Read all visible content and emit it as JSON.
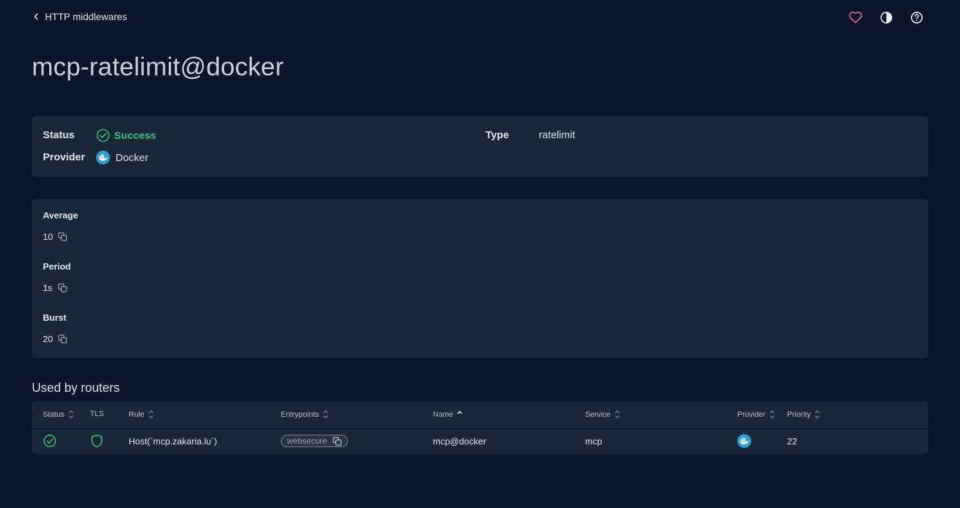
{
  "nav": {
    "back_label": "HTTP middlewares"
  },
  "header": {
    "icons": [
      "heart-icon",
      "contrast-icon",
      "help-icon"
    ]
  },
  "page": {
    "title": "mcp-ratelimit@docker"
  },
  "summary": {
    "status_label": "Status",
    "status_value": "Success",
    "provider_label": "Provider",
    "provider_value": "Docker",
    "type_label": "Type",
    "type_value": "ratelimit"
  },
  "config": {
    "average_label": "Average",
    "average_value": "10",
    "period_label": "Period",
    "period_value": "1s",
    "burst_label": "Burst",
    "burst_value": "20"
  },
  "routers": {
    "section_title": "Used by routers",
    "columns": {
      "status": "Status",
      "tls": "TLS",
      "rule": "Rule",
      "entrypoints": "Entrypoints",
      "name": "Name",
      "service": "Service",
      "provider": "Provider",
      "priority": "Priority"
    },
    "sorted_column": "name",
    "rows": [
      {
        "rule": "Host(`mcp.zakaria.lu`)",
        "entrypoint": "websecure",
        "name": "mcp@docker",
        "service": "mcp",
        "priority": "22"
      }
    ]
  },
  "colors": {
    "background": "#0a1627",
    "card": "#1a2736",
    "success": "#3dbb7b",
    "heart": "#e0609a",
    "docker": "#2b9ed6"
  }
}
